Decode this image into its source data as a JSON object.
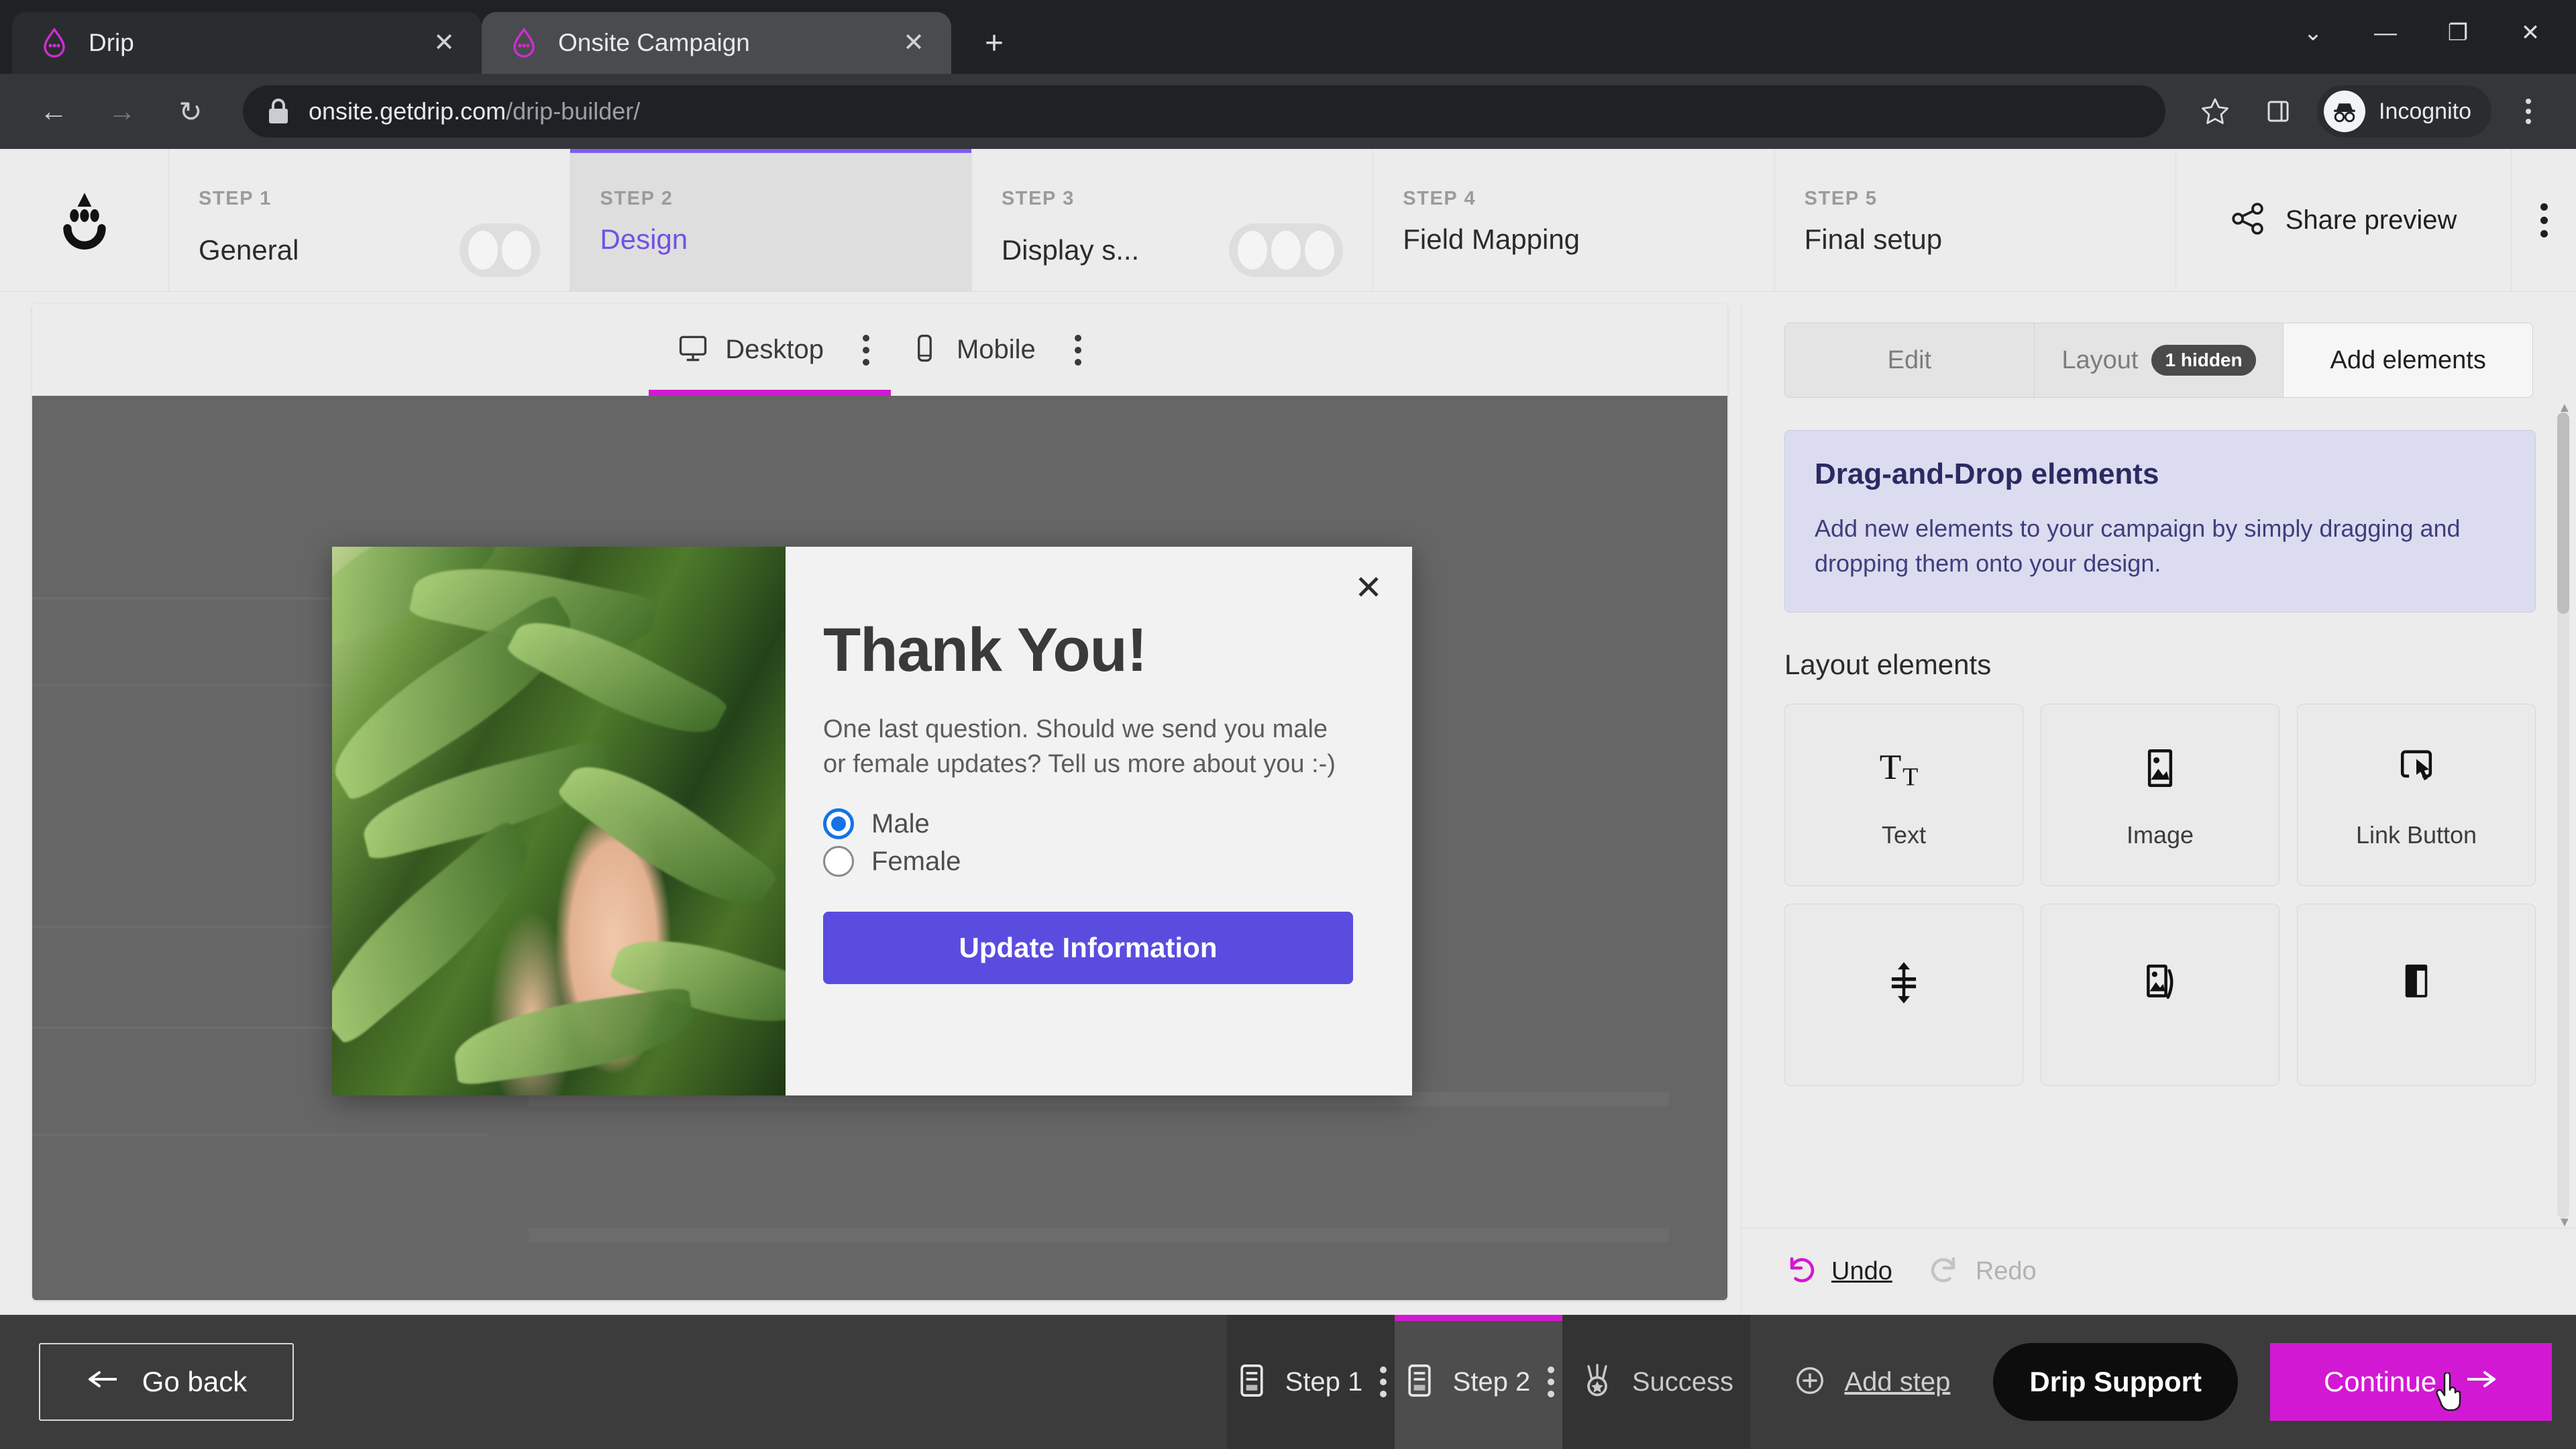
{
  "browser": {
    "tabs": [
      {
        "title": "Drip",
        "favicon": "drip-logo-icon",
        "active": false
      },
      {
        "title": "Onsite Campaign",
        "favicon": "drip-logo-icon",
        "active": true
      }
    ],
    "new_tab_label": "+",
    "window_controls": {
      "minimize": "—",
      "maximize": "❐",
      "close": "✕",
      "chevron": "⌄"
    },
    "nav": {
      "back": "←",
      "forward": "→",
      "reload": "↻"
    },
    "address": {
      "domain": "onsite.getdrip.com",
      "path": "/drip-builder/",
      "lock": "lock-icon"
    },
    "profile_label": "Incognito",
    "star_icon": "star-icon",
    "sidepanel_icon": "side-panel-icon",
    "menu_icon": "chrome-menu-icon"
  },
  "steps_bar": {
    "logo": "drip-face-logo",
    "steps": [
      {
        "kicker": "STEP 1",
        "title": "General",
        "active": false,
        "dots": 2
      },
      {
        "kicker": "STEP 2",
        "title": "Design",
        "active": true,
        "dots": 0
      },
      {
        "kicker": "STEP 3",
        "title": "Display s...",
        "active": false,
        "dots": 3
      },
      {
        "kicker": "STEP 4",
        "title": "Field Mapping",
        "active": false,
        "dots": 0
      },
      {
        "kicker": "STEP 5",
        "title": "Final setup",
        "active": false,
        "dots": 0
      }
    ],
    "share_preview_label": "Share preview",
    "share_icon": "share-nodes-icon",
    "more_icon": "vertical-dots-icon"
  },
  "device_bar": {
    "tabs": [
      {
        "label": "Desktop",
        "icon": "monitor-icon",
        "active": true
      },
      {
        "label": "Mobile",
        "icon": "phone-icon",
        "active": false
      }
    ]
  },
  "popup": {
    "close_label": "✕",
    "heading": "Thank You!",
    "paragraph": "One last question. Should we send you male or female updates? Tell us more about you :-)",
    "options": [
      {
        "label": "Male",
        "selected": true
      },
      {
        "label": "Female",
        "selected": false
      }
    ],
    "cta_label": "Update Information",
    "cta_color": "#5b4ce0",
    "image_alt": "thumbs-up-in-front-of-green-palm-leaves"
  },
  "right_panel": {
    "segments": [
      {
        "label": "Edit",
        "active": false,
        "badge": null
      },
      {
        "label": "Layout",
        "active": false,
        "badge": "1 hidden"
      },
      {
        "label": "Add elements",
        "active": true,
        "badge": null
      }
    ],
    "info_card": {
      "title": "Drag-and-Drop elements",
      "text": "Add new elements to your campaign by simply dragging and dropping them onto your design."
    },
    "section_title": "Layout elements",
    "elements": [
      {
        "label": "Text",
        "icon": "text-tt-icon"
      },
      {
        "label": "Image",
        "icon": "image-icon"
      },
      {
        "label": "Link Button",
        "icon": "link-button-tap-icon"
      },
      {
        "label": "",
        "icon": "spacer-vertical-arrows-icon"
      },
      {
        "label": "",
        "icon": "image-card-icon"
      },
      {
        "label": "",
        "icon": "split-column-icon"
      }
    ],
    "undo": {
      "label": "Undo",
      "icon": "undo-arrow-icon",
      "enabled": true
    },
    "redo": {
      "label": "Redo",
      "icon": "redo-arrow-icon",
      "enabled": false
    }
  },
  "bottom_bar": {
    "go_back_label": "Go back",
    "go_back_icon": "arrow-left-icon",
    "steps": [
      {
        "label": "Step 1",
        "icon": "form-lines-icon",
        "selected": false
      },
      {
        "label": "Step 2",
        "icon": "form-lines-icon",
        "selected": true
      }
    ],
    "success_label": "Success",
    "success_icon": "medal-icon",
    "add_step_label": "Add step",
    "add_step_icon": "plus-circle-icon",
    "support_label": "Drip Support",
    "continue_label": "Continue",
    "continue_icon": "arrow-right-icon",
    "continue_color": "#d318d3"
  },
  "colors": {
    "accent_magenta": "#d318d3",
    "accent_purple": "#6f52e3",
    "cta_purple": "#5b4ce0",
    "canvas_gray": "#666666"
  }
}
